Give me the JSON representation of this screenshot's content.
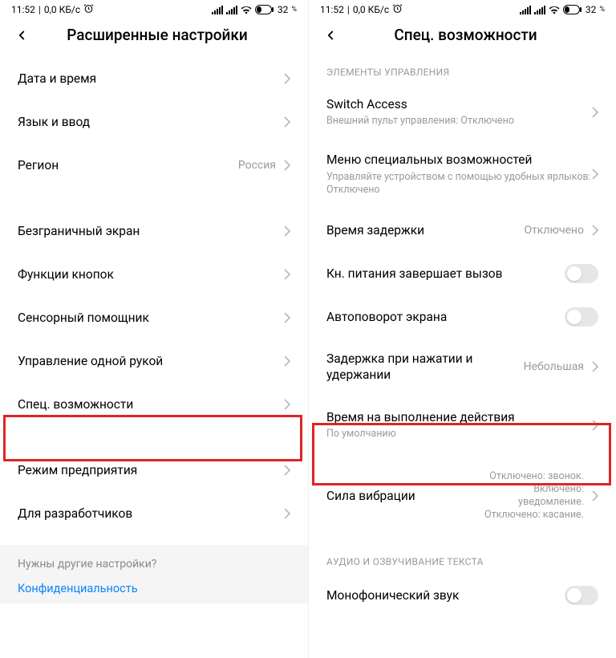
{
  "status": {
    "time": "11:52",
    "net": "0,0 КБ/с",
    "battery_pct": "32",
    "battery_suffix": "%"
  },
  "left": {
    "title": "Расширенные настройки",
    "rows": {
      "datetime": "Дата и время",
      "lang": "Язык и ввод",
      "region": "Регион",
      "region_val": "Россия",
      "fullscreen": "Безграничный экран",
      "buttons": "Функции кнопок",
      "touchassist": "Сенсорный помощник",
      "onehand": "Управление одной рукой",
      "accessibility": "Спец. возможности",
      "enterprise": "Режим предприятия",
      "dev": "Для разработчиков"
    },
    "footer": {
      "question": "Нужны другие настройки?",
      "link": "Конфиденциальность"
    }
  },
  "right": {
    "title": "Спец. возможности",
    "section1": "Элементы управления",
    "section2": "Аудио и озвучивание текста",
    "rows": {
      "switch_title": "Switch Access",
      "switch_sub": "Внешний пульт управления: Отключено",
      "menu_title": "Меню специальных возможностей",
      "menu_sub": "Управляйте устройством с помощью удобных ярлыков: Отключено",
      "delay_title": "Время задержки",
      "delay_val": "Отключено",
      "power_title": "Кн. питания завершает вызов",
      "rotate_title": "Автоповорот экрана",
      "touchdelay_title": "Задержка при нажатии и удержании",
      "touchdelay_val": "Небольшая",
      "action_title": "Время на выполнение действия",
      "action_sub": "По умолчанию",
      "vib_title": "Сила вибрации",
      "vib_val": "Отключено: звонок. Включено: уведомление. Отключено: касание.",
      "mono_title": "Монофонический звук"
    }
  }
}
